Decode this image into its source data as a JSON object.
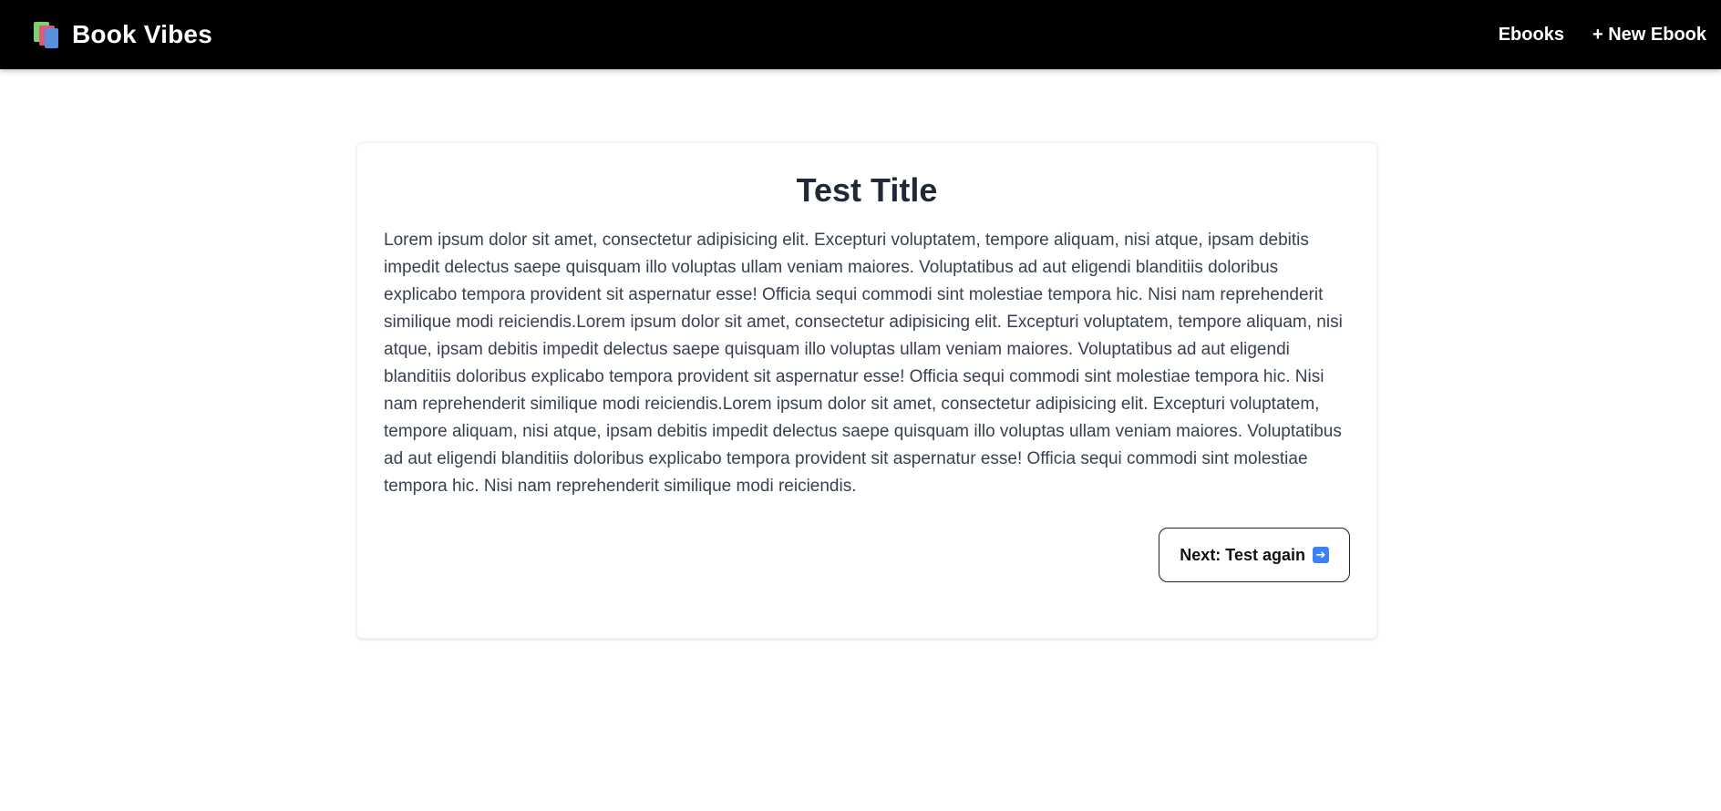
{
  "header": {
    "brand_title": "Book Vibes",
    "brand_icon": "books-icon",
    "nav": {
      "ebooks": "Ebooks",
      "new_ebook": "+ New Ebook"
    }
  },
  "card": {
    "title": "Test Title",
    "body": "Lorem ipsum dolor sit amet, consectetur adipisicing elit. Excepturi voluptatem, tempore aliquam, nisi atque, ipsam debitis impedit delectus saepe quisquam illo voluptas ullam veniam maiores. Voluptatibus ad aut eligendi blanditiis doloribus explicabo tempora provident sit aspernatur esse! Officia sequi commodi sint molestiae tempora hic. Nisi nam reprehenderit similique modi reiciendis.Lorem ipsum dolor sit amet, consectetur adipisicing elit. Excepturi voluptatem, tempore aliquam, nisi atque, ipsam debitis impedit delectus saepe quisquam illo voluptas ullam veniam maiores. Voluptatibus ad aut eligendi blanditiis doloribus explicabo tempora provident sit aspernatur esse! Officia sequi commodi sint molestiae tempora hic. Nisi nam reprehenderit similique modi reiciendis.Lorem ipsum dolor sit amet, consectetur adipisicing elit. Excepturi voluptatem, tempore aliquam, nisi atque, ipsam debitis impedit delectus saepe quisquam illo voluptas ullam veniam maiores. Voluptatibus ad aut eligendi blanditiis doloribus explicabo tempora provident sit aspernatur esse! Officia sequi commodi sint molestiae tempora hic. Nisi nam reprehenderit similique modi reiciendis.",
    "next_label": "Next: Test again",
    "next_icon": "right-arrow-icon"
  },
  "colors": {
    "header_bg": "#000000",
    "title_text": "#1f2937",
    "body_text": "#374151",
    "arrow_icon_bg": "#3b82f6"
  }
}
